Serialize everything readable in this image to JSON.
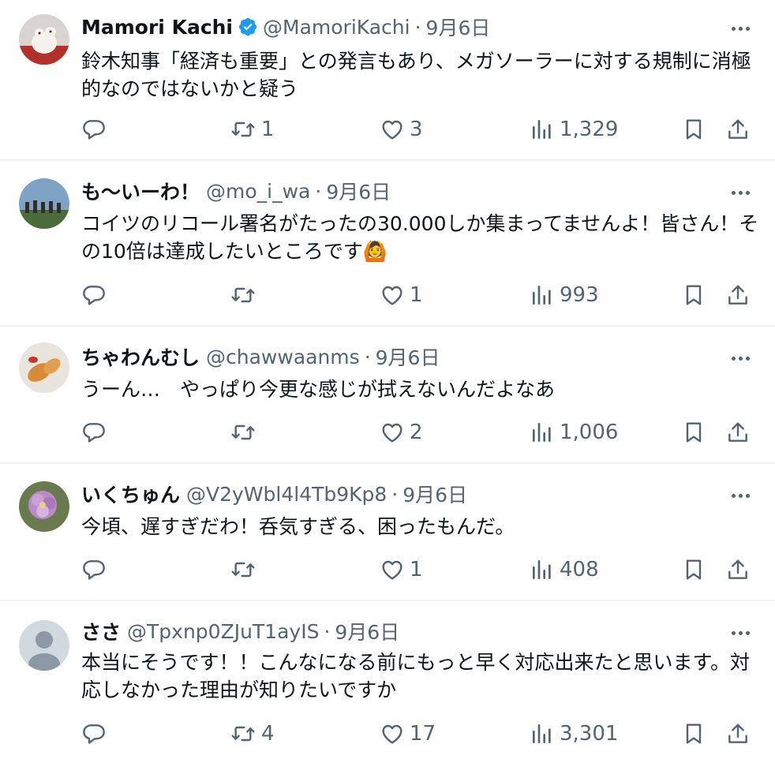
{
  "tweets": [
    {
      "name": "Mamori Kachi",
      "verified": true,
      "handle": "@MamoriKachi",
      "sep": "·",
      "date": "9月6日",
      "text": "鈴木知事「経済も重要」との発言もあり、メガソーラーに対する規制に消極的なのではないかと疑う",
      "retweets": "1",
      "likes": "3",
      "views": "1,329"
    },
    {
      "name": "も〜いーわ！",
      "verified": false,
      "handle": "@mo_i_wa",
      "sep": "·",
      "date": "9月6日",
      "text": "コイツのリコール署名がたったの30.000しか集まってませんよ！皆さん！その10倍は達成したいところです🙆",
      "retweets": "",
      "likes": "1",
      "views": "993"
    },
    {
      "name": "ちゃわんむし",
      "verified": false,
      "handle": "@chawwaanms",
      "sep": "·",
      "date": "9月6日",
      "text": "うーん…　やっぱり今更な感じが拭えないんだよなあ",
      "retweets": "",
      "likes": "2",
      "views": "1,006"
    },
    {
      "name": "いくちゅん",
      "verified": false,
      "handle": "@V2yWbl4l4Tb9Kp8",
      "sep": "·",
      "date": "9月6日",
      "text": "今頃、遅すぎだわ！呑気すぎる、困ったもんだ。",
      "retweets": "",
      "likes": "1",
      "views": "408"
    },
    {
      "name": "ささ",
      "verified": false,
      "handle": "@Tpxnp0ZJuT1ayIS",
      "sep": "·",
      "date": "9月6日",
      "text": "本当にそうです！！こんなになる前にもっと早く対応出来たと思います。対応しなかった理由が知りたいですか",
      "retweets": "4",
      "likes": "17",
      "views": "3,301"
    }
  ],
  "icons": {
    "reply": "reply-icon",
    "retweet": "retweet-icon",
    "like": "heart-icon",
    "views": "views-icon",
    "bookmark": "bookmark-icon",
    "share": "share-icon",
    "more": "more-icon",
    "verified": "verified-badge-icon"
  },
  "colors": {
    "text": "#0f1419",
    "secondary": "#536471",
    "verified": "#1d9bf0",
    "divider": "#eff3f4"
  }
}
